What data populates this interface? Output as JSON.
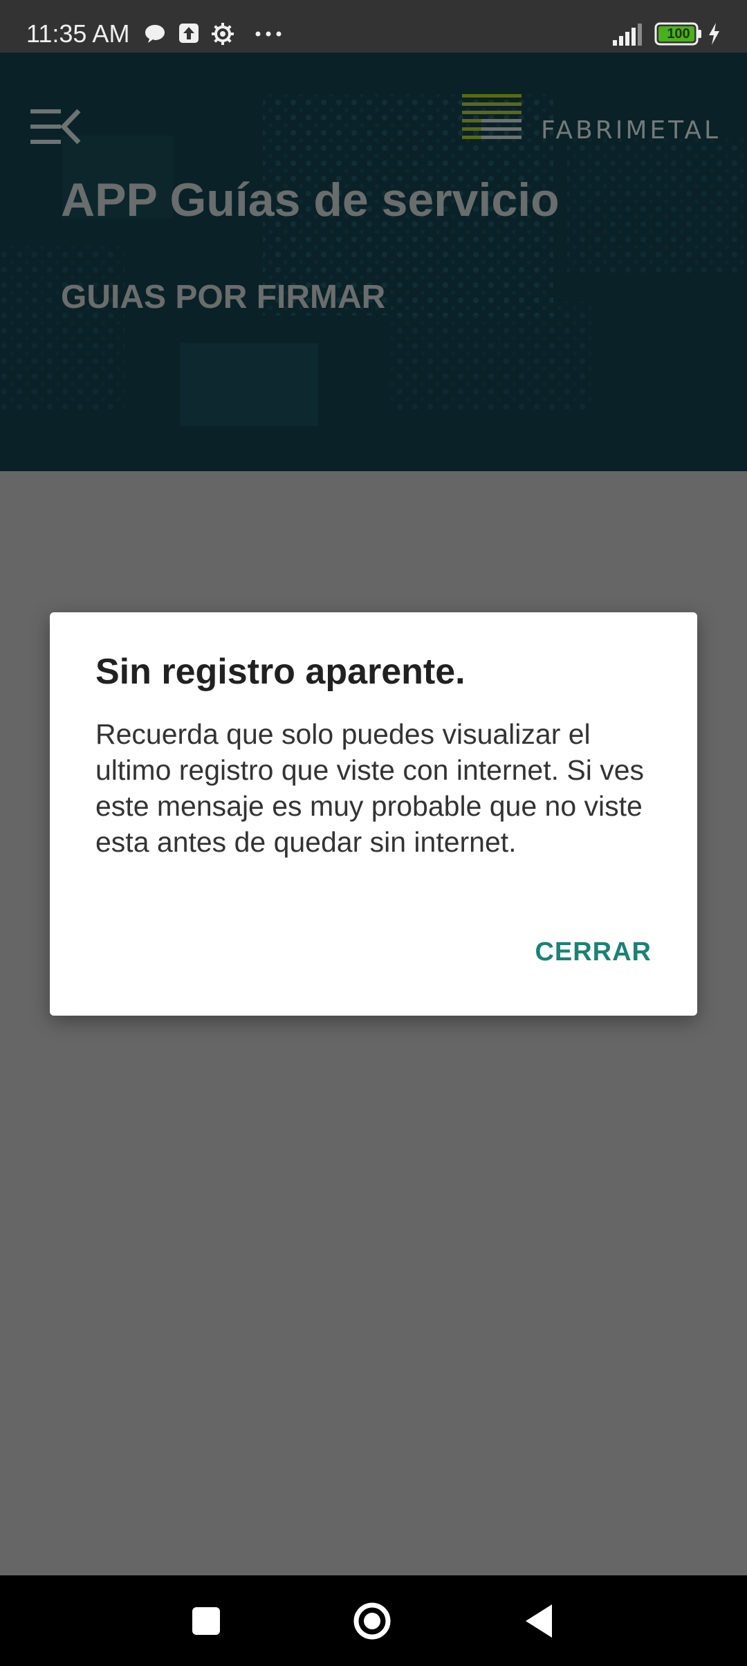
{
  "status_bar": {
    "time": "11:35 AM",
    "battery_level": "100",
    "icons": [
      "chat-bubble-icon",
      "upload-icon",
      "settings-gear-icon",
      "more-dots-icon",
      "signal-icon",
      "battery-icon",
      "charging-bolt-icon"
    ]
  },
  "header": {
    "brand": "FABRIMETAL",
    "app_title": "APP Guías de servicio",
    "section_title": "GUIAS POR FIRMAR",
    "colors": {
      "background": "#0a2127",
      "logo_accent": "#6b7a16"
    }
  },
  "dialog": {
    "title": "Sin registro aparente.",
    "message": "Recuerda que solo puedes visualizar el ultimo registro que viste con internet. Si ves este mensaje es muy probable que no viste esta antes de quedar sin internet.",
    "close_label": "CERRAR",
    "colors": {
      "button": "#1a8275"
    }
  },
  "nav_bar": {
    "icons": [
      "recents-square-icon",
      "home-circle-icon",
      "back-triangle-icon"
    ]
  }
}
